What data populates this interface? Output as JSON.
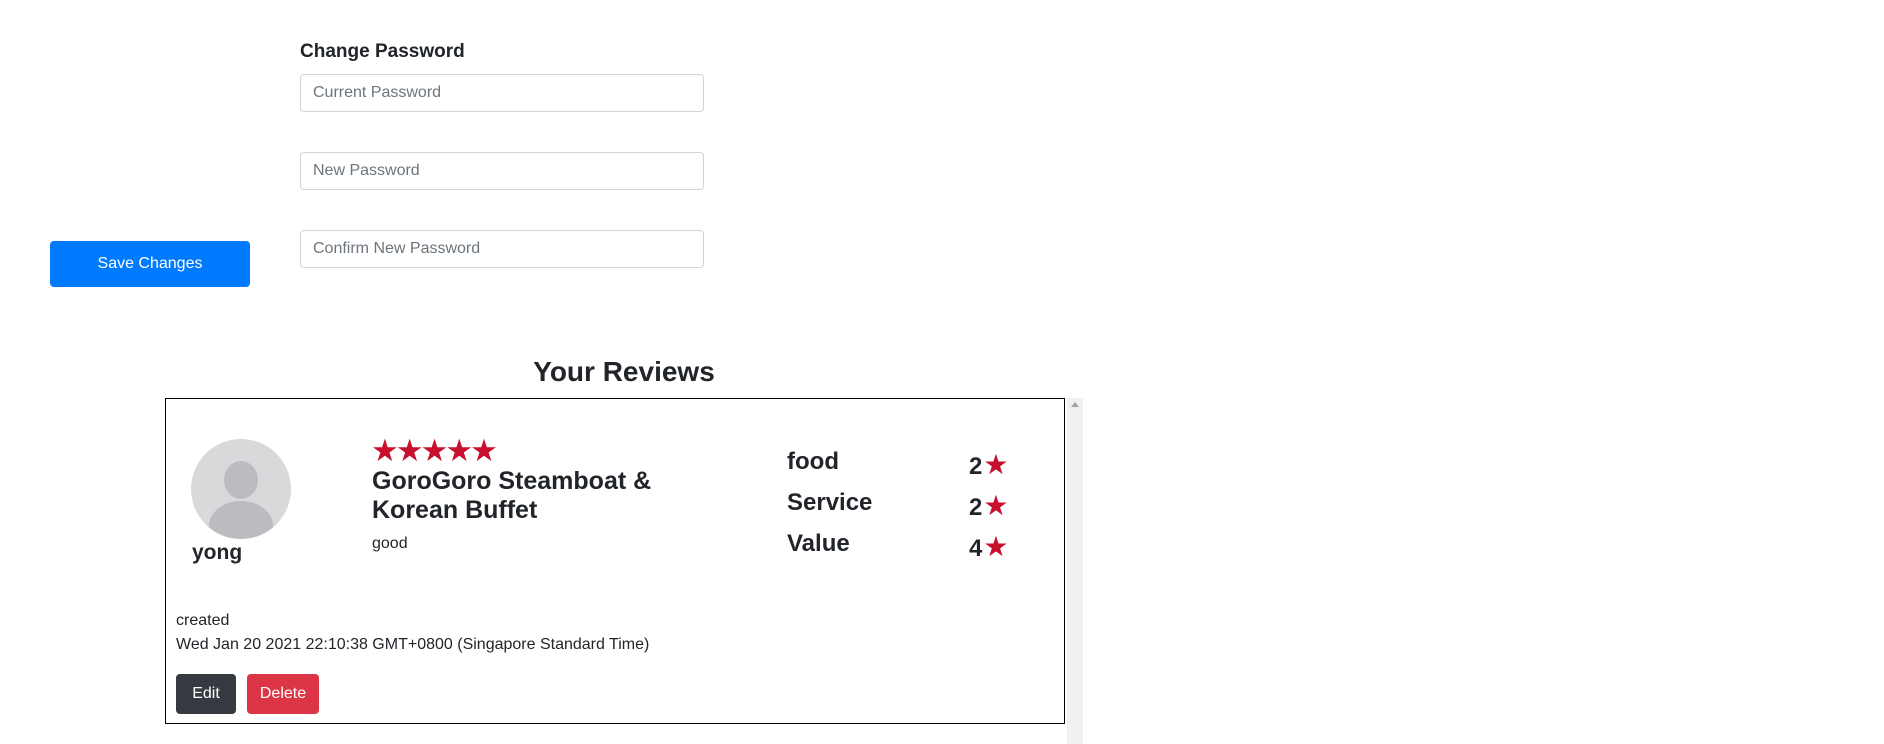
{
  "change_password": {
    "heading": "Change Password",
    "current_placeholder": "Current Password",
    "new_placeholder": "New Password",
    "confirm_placeholder": "Confirm New Password",
    "save_label": "Save Changes"
  },
  "reviews": {
    "title": "Your Reviews",
    "items": [
      {
        "username": "yong",
        "overall_stars": "★★★★★",
        "overall_rating": 5,
        "restaurant": "GoroGoro Steamboat & Korean Buffet",
        "text": "good",
        "categories": [
          {
            "label": "food",
            "score": "2",
            "star": "★"
          },
          {
            "label": "Service",
            "score": "2",
            "star": "★"
          },
          {
            "label": "Value",
            "score": "4",
            "star": "★"
          }
        ],
        "created_label": "created",
        "created_date": "Wed Jan 20 2021 22:10:38 GMT+0800 (Singapore Standard Time)",
        "edit_label": "Edit",
        "delete_label": "Delete"
      }
    ]
  },
  "colors": {
    "primary": "#007bff",
    "danger": "#dc3545",
    "dark": "#343a40",
    "star": "#c8102e"
  },
  "icons": {
    "avatar": "person-silhouette-icon",
    "rating": "star-icon",
    "scroll": "scroll-up-arrow-icon"
  }
}
